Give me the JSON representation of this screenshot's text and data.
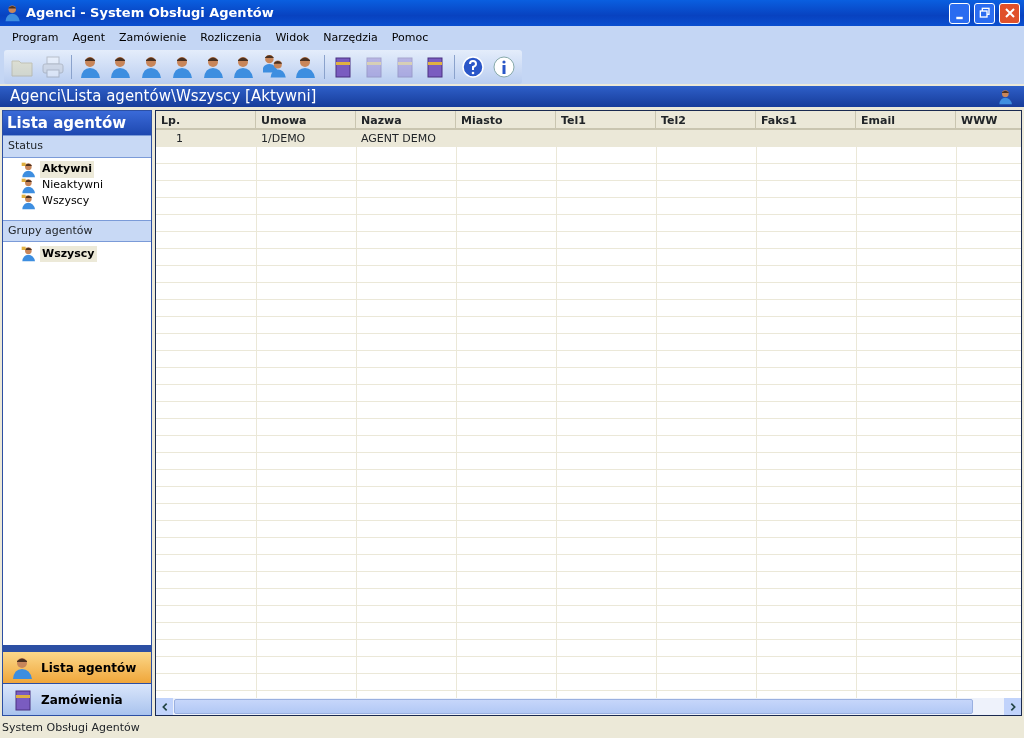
{
  "window": {
    "title": "Agenci - System Obsługi Agentów"
  },
  "menu": [
    {
      "label": "Program"
    },
    {
      "label": "Agent"
    },
    {
      "label": "Zamówienie"
    },
    {
      "label": "Rozliczenia"
    },
    {
      "label": "Widok"
    },
    {
      "label": "Narzędzia"
    },
    {
      "label": "Pomoc"
    }
  ],
  "toolbar": [
    {
      "kind": "folder",
      "disabled": true
    },
    {
      "kind": "printer",
      "disabled": true
    },
    {
      "kind": "separator"
    },
    {
      "kind": "person",
      "disabled": false
    },
    {
      "kind": "person",
      "disabled": false
    },
    {
      "kind": "person",
      "disabled": false
    },
    {
      "kind": "person",
      "disabled": false
    },
    {
      "kind": "person",
      "disabled": false
    },
    {
      "kind": "person",
      "disabled": false
    },
    {
      "kind": "people",
      "disabled": false
    },
    {
      "kind": "person",
      "disabled": false
    },
    {
      "kind": "separator"
    },
    {
      "kind": "book",
      "disabled": false
    },
    {
      "kind": "book",
      "disabled": true
    },
    {
      "kind": "book",
      "disabled": true
    },
    {
      "kind": "book",
      "disabled": false
    },
    {
      "kind": "separator"
    },
    {
      "kind": "help",
      "disabled": false
    },
    {
      "kind": "info",
      "disabled": false
    }
  ],
  "breadcrumb": "Agenci\\Lista agentów\\Wszyscy [Aktywni]",
  "sidebar": {
    "title": "Lista agentów",
    "sections": [
      {
        "title": "Status",
        "items": [
          {
            "label": "Aktywni",
            "selected": true
          },
          {
            "label": "Nieaktywni",
            "selected": false
          },
          {
            "label": "Wszyscy",
            "selected": false
          }
        ]
      },
      {
        "title": "Grupy agentów",
        "items": [
          {
            "label": "Wszyscy",
            "selected": true
          }
        ]
      }
    ],
    "nav": [
      {
        "label": "Lista agentów",
        "kind": "person",
        "selected": true
      },
      {
        "label": "Zamówienia",
        "kind": "book",
        "selected": false
      }
    ]
  },
  "table": {
    "columns": [
      "Lp.",
      "Umowa",
      "Nazwa",
      "Miasto",
      "Tel1",
      "Tel2",
      "Faks1",
      "Email",
      "WWW"
    ],
    "rows": [
      {
        "cells": [
          "1",
          "1/DEMO",
          "AGENT DEMO",
          "",
          "",
          "",
          "",
          "",
          ""
        ],
        "selected": true
      }
    ]
  },
  "status_bar": "System Obsługi Agentów"
}
